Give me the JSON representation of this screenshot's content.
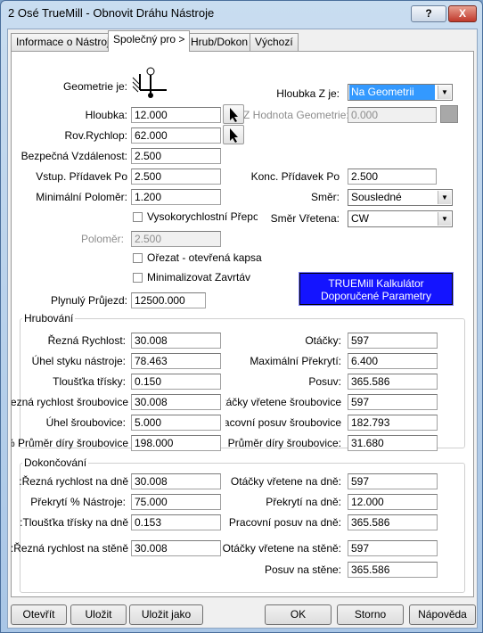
{
  "window": {
    "title": "2 Osé TrueMill - Obnovit Dráhu Nástroje",
    "help": "?",
    "close": "X"
  },
  "tabs": [
    "Informace o Nástroji",
    "Společný pro >",
    "Hrub/Dokon",
    "Výchozí"
  ],
  "geometry": {
    "label": "Geometrie je:",
    "icon": "geometry-icon"
  },
  "z_depth": {
    "label": "Hloubka Z je:",
    "value": "Na Geometrii"
  },
  "depth": {
    "label": "Hloubka:",
    "value": "12.000"
  },
  "z_value_geom": {
    "label": "Z Hodnota Geometrie:",
    "value": "0.000"
  },
  "rapid_plane": {
    "label": "Rov.Rychlop:",
    "value": "62.000"
  },
  "safe_dist": {
    "label": "Bezpečná Vzdálenost:",
    "value": "2.500"
  },
  "entry_allow": {
    "label": "Vstup. Přídavek Po",
    "value": "2.500"
  },
  "final_allow": {
    "label": "Konc. Přídavek Po",
    "value": "2.500"
  },
  "min_radius": {
    "label": "Minimální Poloměr:",
    "value": "1.200"
  },
  "direction": {
    "label": "Směr:",
    "value": "Sousledné"
  },
  "hs_corner": {
    "label": "Vysokorychlostní Přepozic"
  },
  "spindle_dir": {
    "label": "Směr Vřetena:",
    "value": "CW"
  },
  "radius": {
    "label": "Poloměr:",
    "value": "2.500"
  },
  "trim_open": {
    "label": "Ořezat - otevřená kapsa"
  },
  "min_plunge": {
    "label": "Minimalizovat Zavrtáv"
  },
  "calculator": {
    "line1": "TRUEMill Kalkulátor",
    "line2": "Doporučené Parametry"
  },
  "smooth_pass": {
    "label": "Plynulý Průjezd:",
    "value": "12500.000"
  },
  "roughing": {
    "title": "Hrubování",
    "cutting_speed": {
      "label": "Řezná Rychlost:",
      "value": "30.008"
    },
    "rpm": {
      "label": "Otáčky:",
      "value": "597"
    },
    "engage_angle": {
      "label": "Úhel styku nástroje:",
      "value": "78.463"
    },
    "max_overlap": {
      "label": "Maximální Překrytí:",
      "value": "6.400"
    },
    "chip_thick": {
      "label": "Tloušťka třísky:",
      "value": "0.150"
    },
    "feed": {
      "label": "Posuv:",
      "value": "365.586"
    },
    "helix_speed": {
      "label": "Řezná rychlost šroubovice:",
      "value": "30.008"
    },
    "helix_rpm": {
      "label": "Otáčky vřetene šroubovice:",
      "value": "597"
    },
    "helix_angle": {
      "label": "Úhel šroubovice:",
      "value": "5.000"
    },
    "helix_feed": {
      "label": "Pracovní posuv šroubovice:",
      "value": "182.793"
    },
    "helix_dia_pct": {
      "label": "Průměr díry šroubovice %:",
      "value": "198.000"
    },
    "helix_dia": {
      "label": "Průměr díry šroubovice:",
      "value": "31.680"
    }
  },
  "finishing": {
    "title": "Dokončování",
    "floor_speed": {
      "label": "Řezná rychlost na dně:",
      "value": "30.008"
    },
    "floor_rpm": {
      "label": "Otáčky vřetene na dně:",
      "value": "597"
    },
    "overlap_pct": {
      "label": "Překrytí % Nástroje:",
      "value": "75.000"
    },
    "floor_overlap": {
      "label": "Překrytí na dně:",
      "value": "12.000"
    },
    "floor_chip": {
      "label": "Tloušťka třísky na dně:",
      "value": "0.153"
    },
    "floor_feed": {
      "label": "Pracovní posuv na dně:",
      "value": "365.586"
    },
    "wall_speed": {
      "label": "Řezná rychlost na stěně:",
      "value": "30.008"
    },
    "wall_rpm": {
      "label": "Otáčky vřetene na stěně:",
      "value": "597"
    },
    "wall_feed": {
      "label": "Posuv na stěne:",
      "value": "365.586"
    }
  },
  "buttons": {
    "open": "Otevřít",
    "save": "Uložit",
    "save_as": "Uložit jako",
    "ok": "OK",
    "cancel": "Storno",
    "help": "Nápověda"
  }
}
